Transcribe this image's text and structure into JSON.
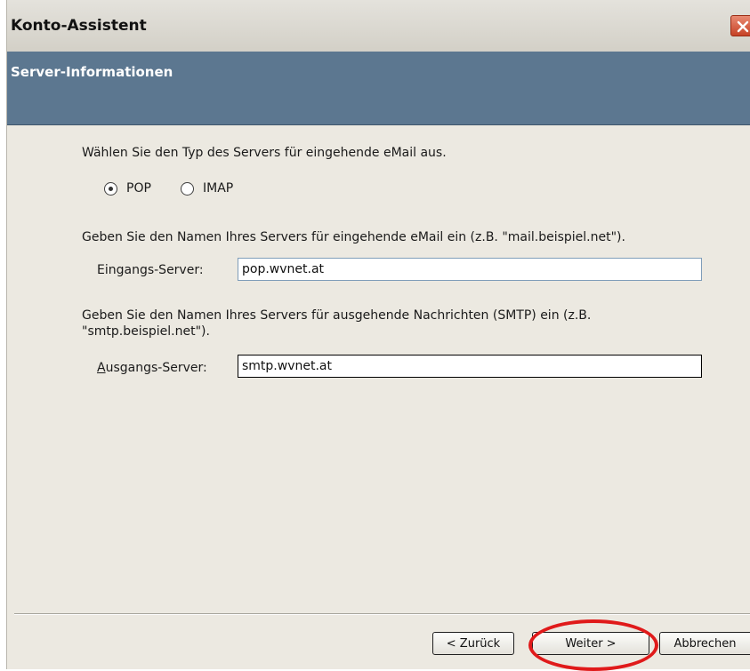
{
  "window": {
    "title": "Konto-Assistent"
  },
  "banner": {
    "title": "Server-Informationen"
  },
  "content": {
    "incoming_type_prompt": "Wählen Sie den Typ des Servers für eingehende eMail aus.",
    "radio_pop_label": "POP",
    "radio_imap_label": "IMAP",
    "selected_type": "POP",
    "incoming_server_prompt": "Geben Sie den Namen Ihres Servers für eingehende eMail ein (z.B. \"mail.beispiel.net\").",
    "incoming_label": "Eingangs-Server:",
    "incoming_value": "pop.wvnet.at",
    "outgoing_server_prompt": "Geben Sie den Namen Ihres Servers für ausgehende Nachrichten (SMTP) ein (z.B. \"smtp.beispiel.net\").",
    "outgoing_label_accesskey": "A",
    "outgoing_label_rest": "usgangs-Server:",
    "outgoing_value": "smtp.wvnet.at"
  },
  "footer": {
    "back_label": "< Zurück",
    "next_label": "Weiter >",
    "cancel_label": "Abbrechen"
  },
  "colors": {
    "banner": "#5c7790",
    "highlight_ring": "#e01a1a"
  }
}
